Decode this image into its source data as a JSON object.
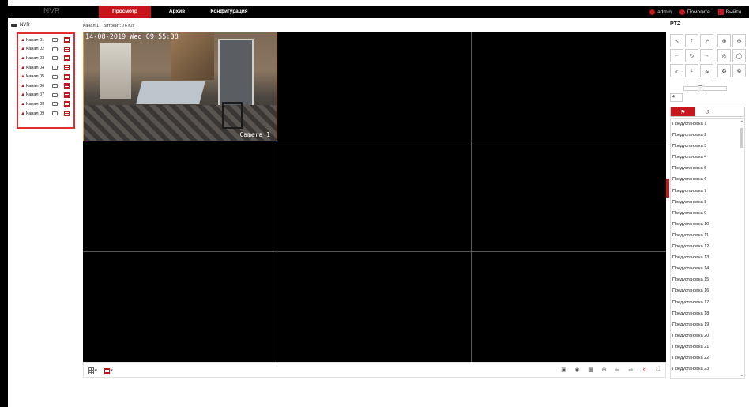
{
  "topbar": {
    "logo": "NVR",
    "tabs": [
      {
        "label": "Просмотр",
        "active": true
      },
      {
        "label": "Архив",
        "active": false
      },
      {
        "label": "Конфигурация",
        "active": false
      }
    ],
    "user": "admin",
    "help": "Помогите",
    "logout": "Выйти"
  },
  "tree": {
    "root": "NVR",
    "channels": [
      "Канал 01",
      "Канал 02",
      "Канал 03",
      "Канал 04",
      "Канал 05",
      "Канал 06",
      "Канал 07",
      "Канал 08",
      "Канал 09"
    ]
  },
  "info": {
    "channel": "Канал 1",
    "bitrate": "Битрейт: 76 K/s"
  },
  "camera": {
    "osd": "14-08-2019 Wed 09:55:38",
    "name": "Camera 1"
  },
  "ptz": {
    "title": "PTZ",
    "speed": "4",
    "presets": [
      "Предустановка 1",
      "Предустановка 2",
      "Предустановка 3",
      "Предустановка 4",
      "Предустановка 5",
      "Предустановка 6",
      "Предустановка 7",
      "Предустановка 8",
      "Предустановка 9",
      "Предустановка 10",
      "Предустановка 11",
      "Предустановка 12",
      "Предустановка 13",
      "Предустановка 14",
      "Предустановка 15",
      "Предустановка 16",
      "Предустановка 17",
      "Предустановка 18",
      "Предустановка 19",
      "Предустановка 20",
      "Предустановка 21",
      "Предустановка 22",
      "Предустановка 23"
    ]
  },
  "colors": {
    "accent": "#c8151b",
    "selected_border": "#e0a020"
  }
}
